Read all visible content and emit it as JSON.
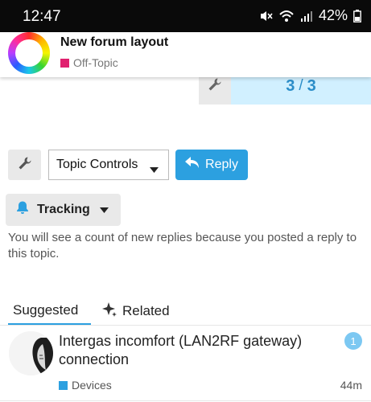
{
  "status_bar": {
    "time": "12:47",
    "battery": "42%",
    "icons": [
      "mute-icon",
      "wifi-icon",
      "signal-icon",
      "battery-icon"
    ]
  },
  "topic": {
    "title": "New forum layout",
    "category": "Off-Topic",
    "category_color": "#e0216f"
  },
  "progress": {
    "current": "3",
    "separator": "/",
    "total": "3"
  },
  "controls": {
    "topic_controls_label": "Topic Controls",
    "reply_label": "Reply",
    "tracking_label": "Tracking",
    "tracking_description": "You will see a count of new replies because you posted a reply to this topic."
  },
  "tabs": [
    {
      "label": "Suggested",
      "active": true
    },
    {
      "label": "Related",
      "active": false
    }
  ],
  "suggested_topics": [
    {
      "title": "Intergas incomfort (LAN2RF gateway) connection",
      "category": "Devices",
      "category_color": "#2ca0e0",
      "unread": "1",
      "age": "44m"
    }
  ],
  "colors": {
    "accent": "#2ca0e0",
    "progress_bg": "#d1f0ff"
  }
}
